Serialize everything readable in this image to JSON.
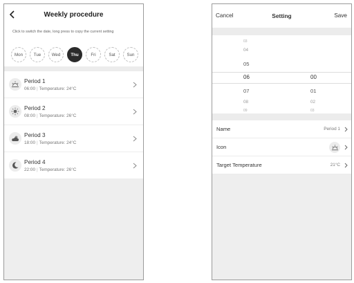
{
  "weekly": {
    "title": "Weekly procedure",
    "hint": "Click to switch the date, long press to copy the current setting",
    "days": [
      "Mon",
      "Tue",
      "Wed",
      "Thu",
      "Fri",
      "Sat",
      "Sun"
    ],
    "selected_day": "Thu",
    "periods": [
      {
        "name": "Period 1",
        "time": "06:00",
        "temperature": "Temperature: 24°C",
        "icon": "sunrise-icon"
      },
      {
        "name": "Period 2",
        "time": "08:00",
        "temperature": "Temperature: 26°C",
        "icon": "sun-icon"
      },
      {
        "name": "Period 3",
        "time": "18:00",
        "temperature": "Temperature: 24°C",
        "icon": "cloud-sun-icon"
      },
      {
        "name": "Period 4",
        "time": "22:00",
        "temperature": "Temperature: 26°C",
        "icon": "moon-icon"
      }
    ]
  },
  "setting": {
    "cancel": "Cancel",
    "title": "Setting",
    "save": "Save",
    "hour_options": [
      "03",
      "04",
      "05",
      "06",
      "07",
      "08",
      "09"
    ],
    "minute_options": [
      "00",
      "01",
      "02",
      "03"
    ],
    "selected_hour": "06",
    "selected_minute": "00",
    "rows": {
      "name_label": "Name",
      "name_value": "Period 1",
      "icon_label": "Icon",
      "icon_value": "sunrise-icon",
      "temp_label": "Target Temperature",
      "temp_value": "21°C"
    }
  },
  "colors": {
    "selected_day_bg": "#2b2b2b",
    "separator": "#ececec"
  }
}
